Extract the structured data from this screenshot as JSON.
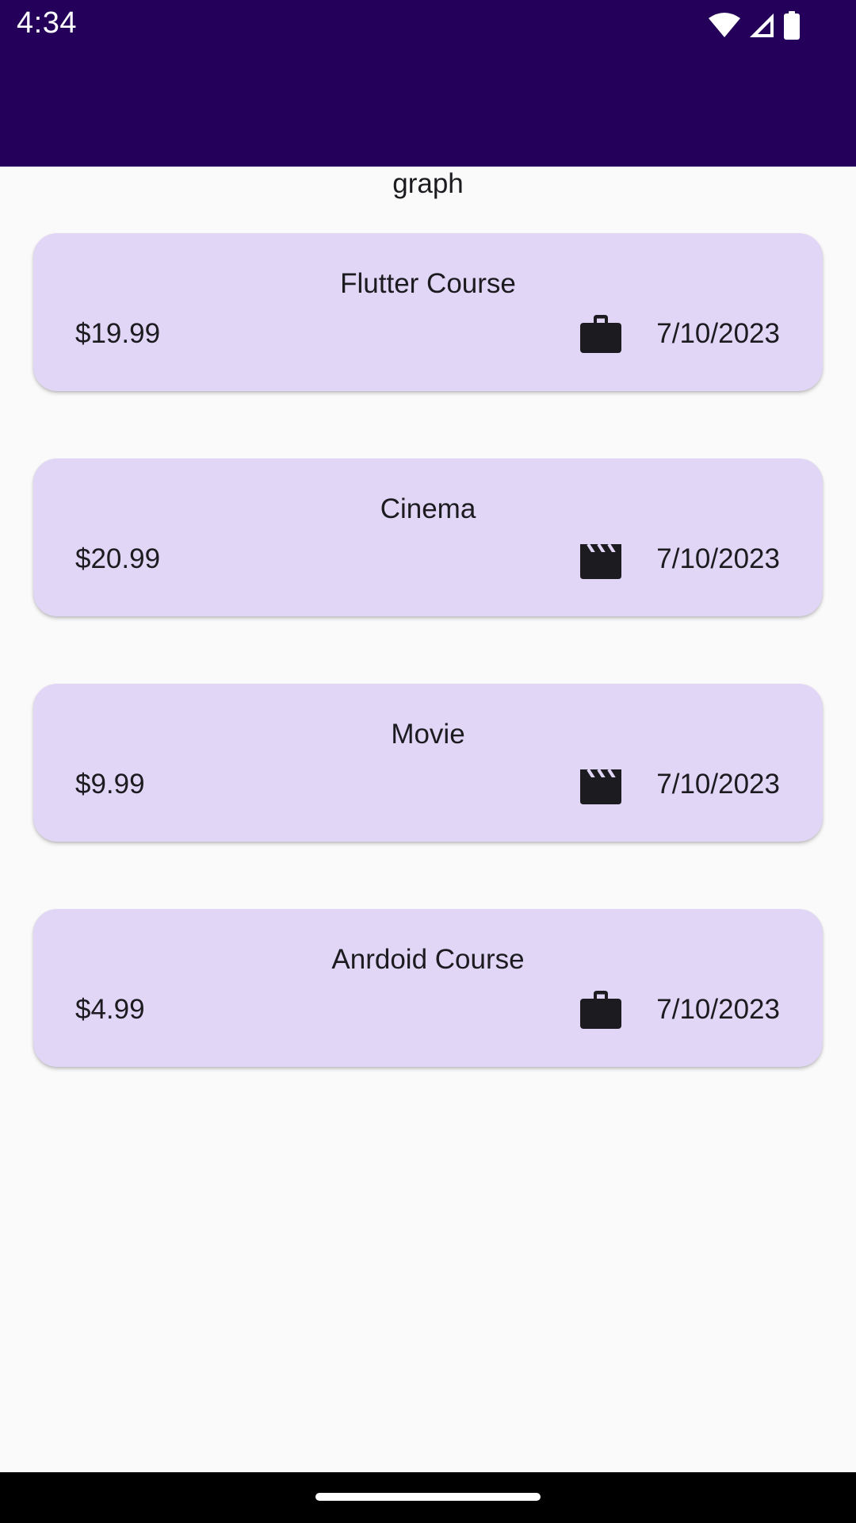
{
  "status_bar": {
    "time": "4:34",
    "icons": [
      "wifi-icon",
      "signal-icon",
      "battery-icon"
    ]
  },
  "colors": {
    "app_bar": "#25005a",
    "card_background": "#e1d6f6",
    "page_background": "#fafafa",
    "text": "#1c1b1f"
  },
  "header": {
    "label": "graph"
  },
  "transactions": [
    {
      "title": "Flutter Course",
      "amount": "$19.99",
      "icon": "briefcase-icon",
      "date": "7/10/2023"
    },
    {
      "title": "Cinema",
      "amount": "$20.99",
      "icon": "movie-clapper-icon",
      "date": "7/10/2023"
    },
    {
      "title": "Movie",
      "amount": "$9.99",
      "icon": "movie-clapper-icon",
      "date": "7/10/2023"
    },
    {
      "title": "Anrdoid Course",
      "amount": "$4.99",
      "icon": "briefcase-icon",
      "date": "7/10/2023"
    }
  ]
}
